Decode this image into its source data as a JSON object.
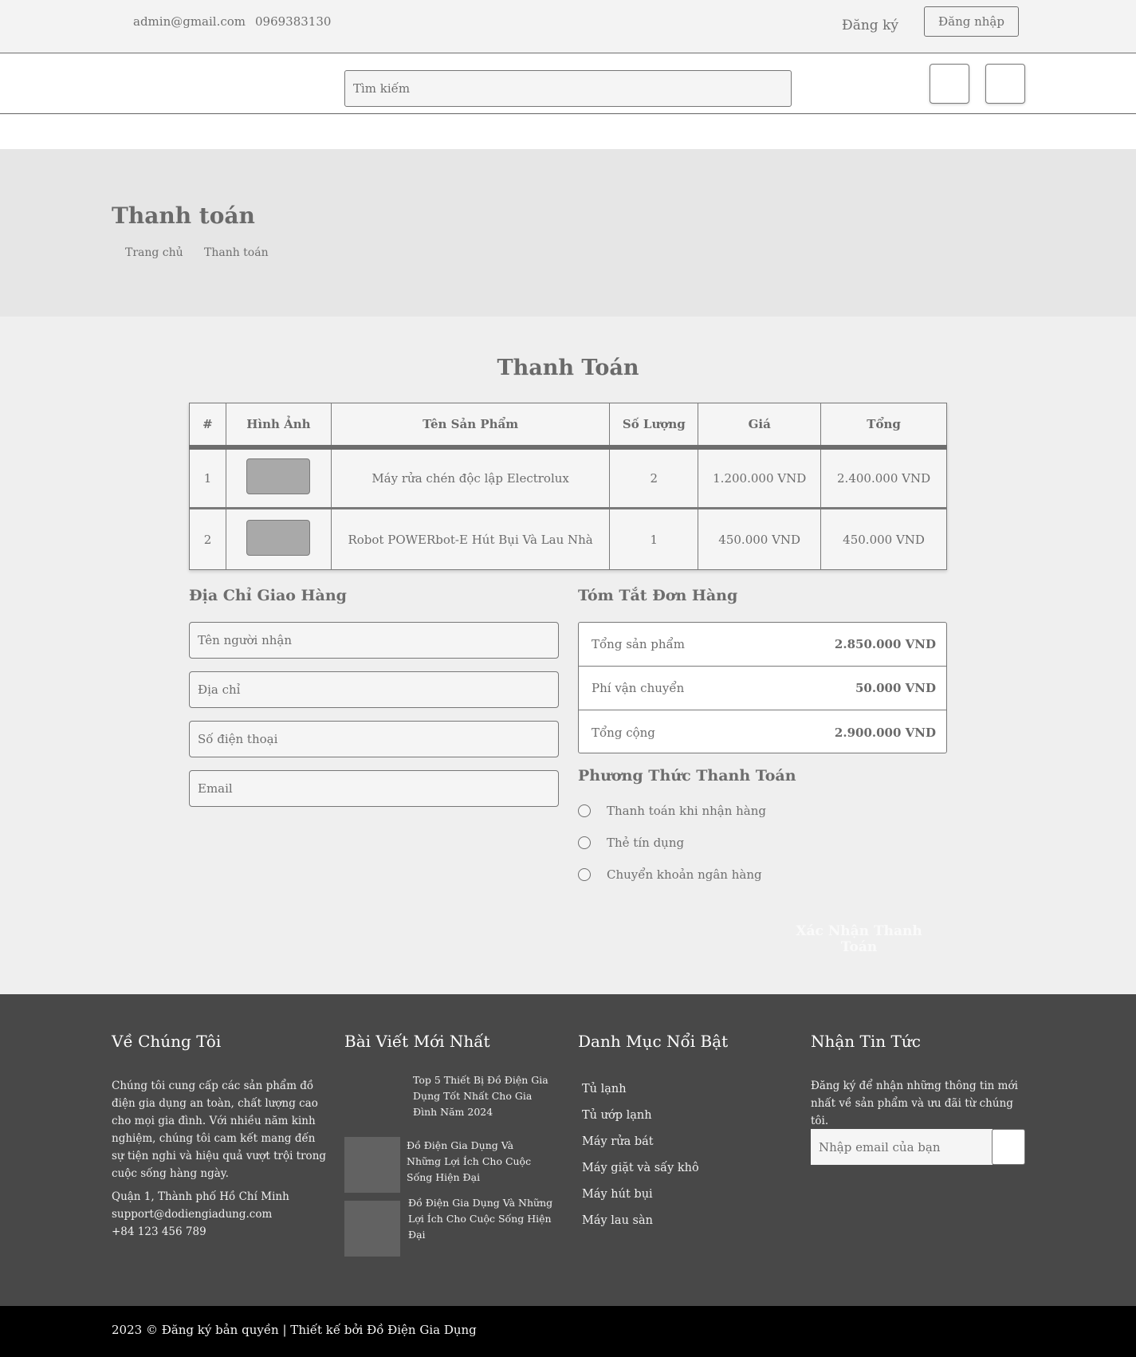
{
  "topbar": {
    "email": "admin@gmail.com",
    "phone": "0969383130",
    "register": "Đăng ký",
    "login": "Đăng nhập"
  },
  "search": {
    "placeholder": "Tìm kiếm"
  },
  "icons": {
    "cart": "cart-icon",
    "user": "user-icon"
  },
  "hero": {
    "title": "Thanh toán",
    "breadcrumb": [
      "Trang chủ",
      "Thanh toán"
    ]
  },
  "main": {
    "title": "Thanh Toán"
  },
  "cart": {
    "headers": [
      "#",
      "Hình Ảnh",
      "Tên Sản Phẩm",
      "Số Lượng",
      "Giá",
      "Tổng"
    ],
    "rows": [
      {
        "index": "1",
        "name": "Máy rửa chén độc lập Electrolux",
        "qty": "2",
        "price": "1.200.000 VND",
        "total": "2.400.000 VND"
      },
      {
        "index": "2",
        "name": "Robot POWERbot-E Hút Bụi Và Lau Nhà",
        "qty": "1",
        "price": "450.000 VND",
        "total": "450.000 VND"
      }
    ]
  },
  "address": {
    "heading": "Địa Chỉ Giao Hàng",
    "name_ph": "Tên người nhận",
    "addr_ph": "Địa chỉ",
    "phone_ph": "Số điện thoại",
    "email_ph": "Email"
  },
  "summary": {
    "heading": "Tóm Tắt Đơn Hàng",
    "rows": [
      {
        "label": "Tổng sản phẩm",
        "value": "2.850.000 VND"
      },
      {
        "label": "Phí vận chuyển",
        "value": "50.000 VND"
      },
      {
        "label": "Tổng cộng",
        "value": "2.900.000 VND"
      }
    ]
  },
  "payment": {
    "heading": "Phương Thức Thanh Toán",
    "options": [
      "Thanh toán khi nhận hàng",
      "Thẻ tín dụng",
      "Chuyển khoản ngân hàng"
    ],
    "confirm": "Xác Nhận Thanh Toán"
  },
  "footer": {
    "about": {
      "heading": "Về Chúng Tôi",
      "text": "Chúng tôi cung cấp các sản phẩm đồ điện gia dụng an toàn, chất lượng cao cho mọi gia đình. Với nhiều năm kinh nghiệm, chúng tôi cam kết mang đến sự tiện nghi và hiệu quả vượt trội trong cuộc sống hàng ngày.",
      "address": "Quận 1, Thành phố Hồ Chí Minh",
      "email": "support@dodiengiadung.com",
      "phone": "+84 123 456 789"
    },
    "posts": {
      "heading": "Bài Viết Mới Nhất",
      "items": [
        "Top 5 Thiết Bị Đồ Điện Gia Dụng Tốt Nhất Cho Gia Đình Năm 2024",
        "Đồ Điện Gia Dụng Và Những Lợi Ích Cho Cuộc Sống Hiện Đại",
        "Đồ Điện Gia Dụng Và Những Lợi Ích Cho Cuộc Sống Hiện Đại"
      ]
    },
    "categories": {
      "heading": "Danh Mục Nổi Bật",
      "items": [
        "Tủ lạnh",
        "Tủ ướp lạnh",
        "Máy rửa bát",
        "Máy giặt và sấy khô",
        "Máy hút bụi",
        "Máy lau sàn"
      ]
    },
    "newsletter": {
      "heading": "Nhận Tin Tức",
      "text": "Đăng ký để nhận những thông tin mới nhất về sản phẩm và ưu đãi từ chúng tôi.",
      "placeholder": "Nhập email của bạn"
    },
    "copyright": "2023 © Đăng ký bản quyền | Thiết kế bởi Đồ Điện Gia Dụng"
  }
}
